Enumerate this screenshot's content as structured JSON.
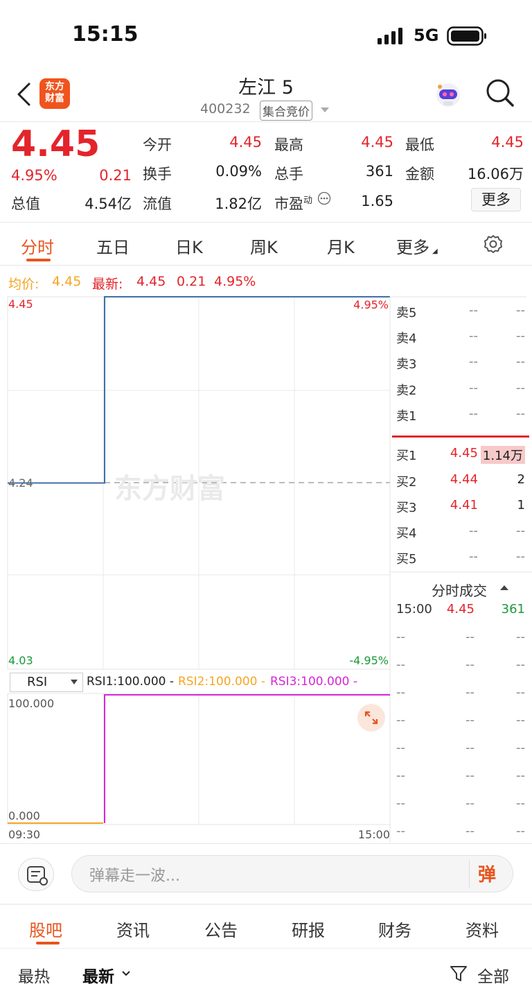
{
  "status": {
    "time": "15:15",
    "network": "5G"
  },
  "header": {
    "logo_text_1": "东方",
    "logo_text_2": "财富",
    "stock_name": "左江 5",
    "stock_code": "400232",
    "auction_tag": "集合竞价"
  },
  "quote": {
    "price": "4.45",
    "change_pct": "4.95%",
    "change": "0.21",
    "open_label": "今开",
    "open": "4.45",
    "high_label": "最高",
    "high": "4.45",
    "low_label": "最低",
    "low": "4.45",
    "turnover_label": "换手",
    "turnover": "0.09%",
    "volume_label": "总手",
    "volume": "361",
    "amount_label": "金额",
    "amount": "16.06万",
    "mktcap_label": "总值",
    "mktcap": "4.54亿",
    "float_label": "流值",
    "float": "1.82亿",
    "pe_label": "市盈",
    "pe_sup": "动",
    "pe": "1.65",
    "more_button": "更多"
  },
  "chart_tabs": [
    "分时",
    "五日",
    "日K",
    "周K",
    "月K",
    "更多"
  ],
  "info_line": {
    "avg_label": "均价:",
    "avg": "4.45",
    "latest_label": "最新:",
    "latest": "4.45",
    "change": "0.21",
    "change_pct": "4.95%"
  },
  "chart_data": [
    {
      "type": "line",
      "x": [
        "09:30",
        "09:30",
        "15:00"
      ],
      "series": [
        {
          "values": [
            4.24,
            4.45,
            4.45
          ]
        }
      ],
      "ylim": [
        4.03,
        4.45
      ],
      "y_tick_labels": [
        "4.45",
        "4.24",
        "4.03"
      ],
      "right_tick_labels": [
        "4.95%",
        "-4.95%"
      ],
      "x_tick_labels": [
        "09:30",
        "15:00"
      ],
      "watermark": "东方财富"
    },
    {
      "type": "line",
      "x": [
        "09:30",
        "09:30",
        "15:00"
      ],
      "series": [
        {
          "values": [
            0,
            100,
            100
          ]
        }
      ],
      "ylim": [
        0,
        100
      ],
      "y_tick_labels": [
        "100.000",
        "0.000"
      ]
    }
  ],
  "orderbook": {
    "asks": [
      {
        "label": "卖5",
        "price": "--",
        "vol": "--"
      },
      {
        "label": "卖4",
        "price": "--",
        "vol": "--"
      },
      {
        "label": "卖3",
        "price": "--",
        "vol": "--"
      },
      {
        "label": "卖2",
        "price": "--",
        "vol": "--"
      },
      {
        "label": "卖1",
        "price": "--",
        "vol": "--"
      }
    ],
    "bids": [
      {
        "label": "买1",
        "price": "4.45",
        "vol": "1.14万"
      },
      {
        "label": "买2",
        "price": "4.44",
        "vol": "2"
      },
      {
        "label": "买3",
        "price": "4.41",
        "vol": "1"
      },
      {
        "label": "买4",
        "price": "--",
        "vol": "--"
      },
      {
        "label": "买5",
        "price": "--",
        "vol": "--"
      }
    ]
  },
  "ticks": {
    "title": "分时成交",
    "rows": [
      {
        "time": "15:00",
        "price": "4.45",
        "vol": "361"
      },
      {
        "time": "--",
        "price": "--",
        "vol": "--"
      },
      {
        "time": "--",
        "price": "--",
        "vol": "--"
      },
      {
        "time": "--",
        "price": "--",
        "vol": "--"
      },
      {
        "time": "--",
        "price": "--",
        "vol": "--"
      },
      {
        "time": "--",
        "price": "--",
        "vol": "--"
      },
      {
        "time": "--",
        "price": "--",
        "vol": "--"
      },
      {
        "time": "--",
        "price": "--",
        "vol": "--"
      },
      {
        "time": "--",
        "price": "--",
        "vol": "--"
      }
    ]
  },
  "rsi": {
    "select_label": "RSI",
    "rsi1": "RSI1:100.000 -",
    "rsi2": "RSI2:100.000 -",
    "rsi3": "RSI3:100.000 -"
  },
  "comment": {
    "placeholder": "弹幕走一波...",
    "danmu": "弹"
  },
  "bottom_tabs": [
    "股吧",
    "资讯",
    "公告",
    "研报",
    "财务",
    "资料"
  ],
  "sort": {
    "hot": "最热",
    "latest": "最新",
    "filter": "全部"
  },
  "colors": {
    "up": "#e3242b",
    "down": "#1a9a3a",
    "accent": "#e8541e",
    "price_line": "#3d6fa8",
    "rsi1_line": "#d626d6"
  }
}
